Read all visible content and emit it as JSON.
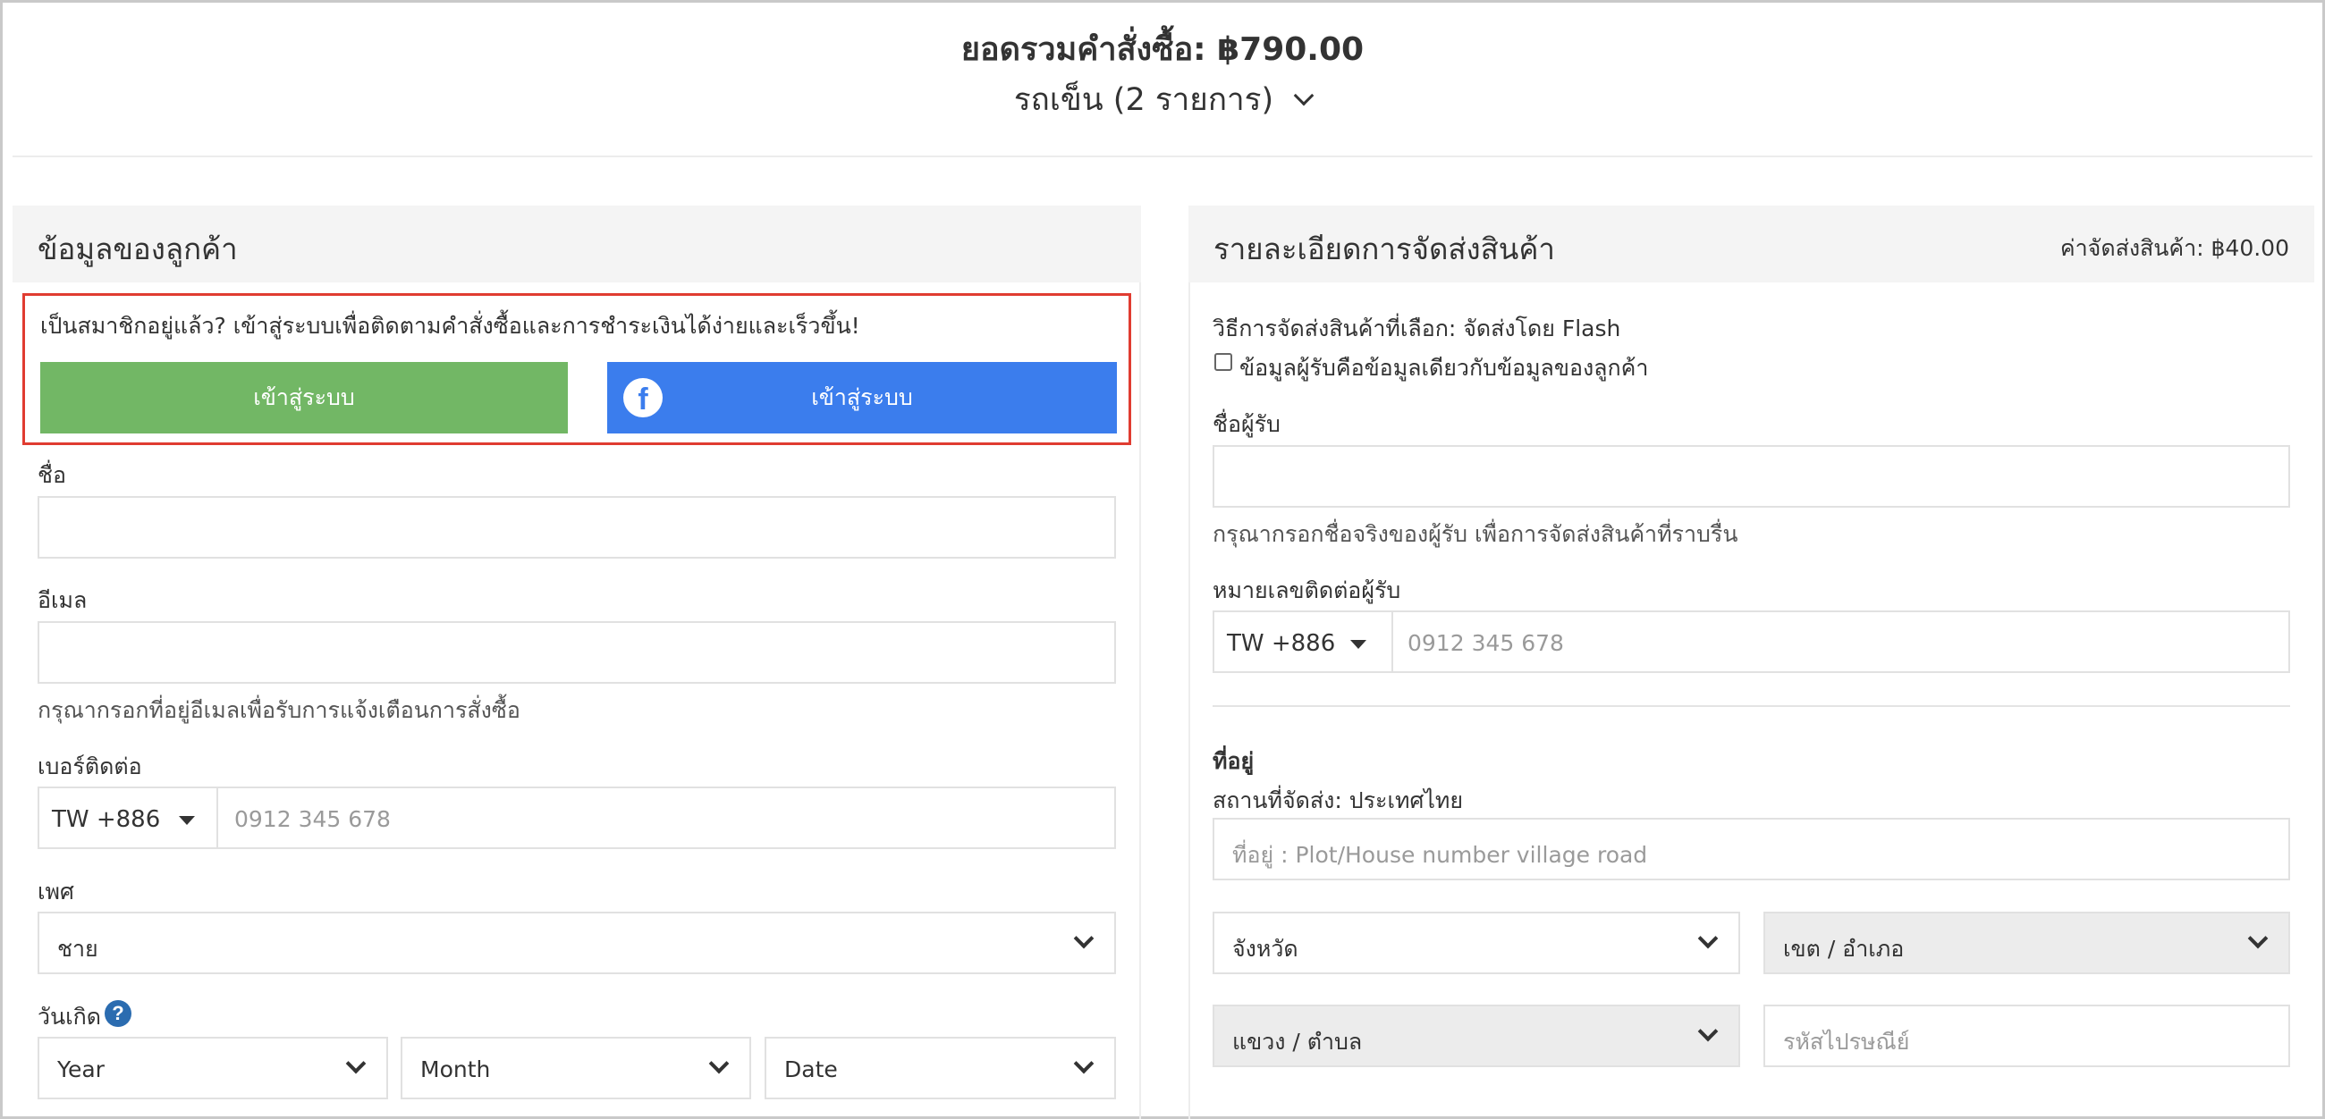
{
  "summary": {
    "total": "ยอดรวมคำสั่งซื้อ: ฿790.00",
    "cart": "รถเข็น (2 รายการ)"
  },
  "customer": {
    "title": "ข้อมูลของลูกค้า",
    "login_prompt": "เป็นสมาชิกอยู่แล้ว? เข้าสู่ระบบเพื่อติดตามคำสั่งซื้อและการชำระเงินได้ง่ายและเร็วขึ้น!",
    "login_button": "เข้าสู่ระบบ",
    "facebook_login_button": "เข้าสู่ระบบ",
    "facebook_glyph": "f",
    "name_label": "ชื่อ",
    "email_label": "อีเมล",
    "email_hint": "กรุณากรอกที่อยู่อีเมลเพื่อรับการแจ้งเตือนการสั่งซื้อ",
    "phone_label": "เบอร์ติดต่อ",
    "phone_code": "TW +886",
    "phone_placeholder": "0912 345 678",
    "gender_label": "เพศ",
    "gender_value": "ชาย",
    "birthday_label": "วันเกิด",
    "help_glyph": "?",
    "birthday_year": "Year",
    "birthday_month": "Month",
    "birthday_date": "Date"
  },
  "shipping": {
    "title": "รายละเอียดการจัดส่งสินค้า",
    "fee": "ค่าจัดส่งสินค้า: ฿40.00",
    "method": "วิธีการจัดส่งสินค้าที่เลือก: จัดส่งโดย Flash",
    "same_as_customer": "ข้อมูลผู้รับคือข้อมูลเดียวกับข้อมูลของลูกค้า",
    "recipient_name_label": "ชื่อผู้รับ",
    "recipient_name_hint": "กรุณากรอกชื่อจริงของผู้รับ เพื่อการจัดส่งสินค้าที่ราบรื่น",
    "recipient_phone_label": "หมายเลขติดต่อผู้รับ",
    "phone_code": "TW +886",
    "phone_placeholder": "0912 345 678",
    "address_label": "ที่อยู่",
    "destination": "สถานที่จัดส่ง: ประเทศไทย",
    "address_placeholder": "ที่อยู่ : Plot/House number village road",
    "province": "จังหวัด",
    "district": "เขต / อำเภอ",
    "subdistrict": "แขวง / ตำบล",
    "postcode_placeholder": "รหัสไปรษณีย์"
  }
}
